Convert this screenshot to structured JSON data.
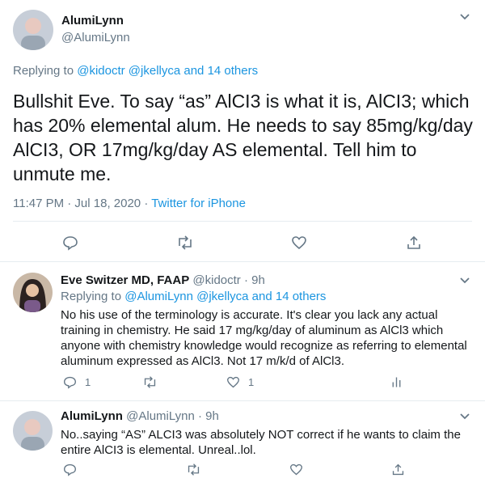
{
  "main_tweet": {
    "name": "AlumiLynn",
    "handle": "@AlumiLynn",
    "replying_prefix": "Replying to ",
    "replying_to": "@kidoctr @jkellyca and 14 others",
    "text": "Bullshit Eve. To say “as” AlCI3 is what it is, AlCI3; which has 20% elemental alum.  He needs to say 85mg/kg/day AlCI3, OR 17mg/kg/day AS elemental. Tell him to unmute me.",
    "timestamp": "11:47 PM · Jul 18, 2020 · ",
    "source": "Twitter for iPhone"
  },
  "reply1": {
    "name": "Eve Switzer MD, FAAP",
    "handle": "@kidoctr",
    "time": "· 9h",
    "replying_prefix": "Replying to ",
    "replying_to": "@AlumiLynn @jkellyca and 14 others",
    "text": "No his use of the terminology is accurate. It's clear you lack any actual training in chemistry. He said 17 mg/kg/day of aluminum as AlCl3 which anyone with chemistry knowledge would recognize as referring to elemental aluminum expressed as AlCl3. Not 17 m/k/d of AlCl3.",
    "reply_count": "1",
    "like_count": "1"
  },
  "reply2": {
    "name": "AlumiLynn",
    "handle": "@AlumiLynn",
    "time": "· 9h",
    "text": "No..saying “AS” ALCI3 was absolutely NOT correct if he wants to claim the entire AlCI3 is elemental. Unreal..lol."
  },
  "icons": {
    "chevron": "chevron-down-icon",
    "reply": "reply-icon",
    "retweet": "retweet-icon",
    "like": "heart-icon",
    "share": "share-icon",
    "analytics": "analytics-icon"
  },
  "colors": {
    "link": "#1b95e0",
    "muted": "#657786",
    "divider": "#e6ecf0"
  }
}
